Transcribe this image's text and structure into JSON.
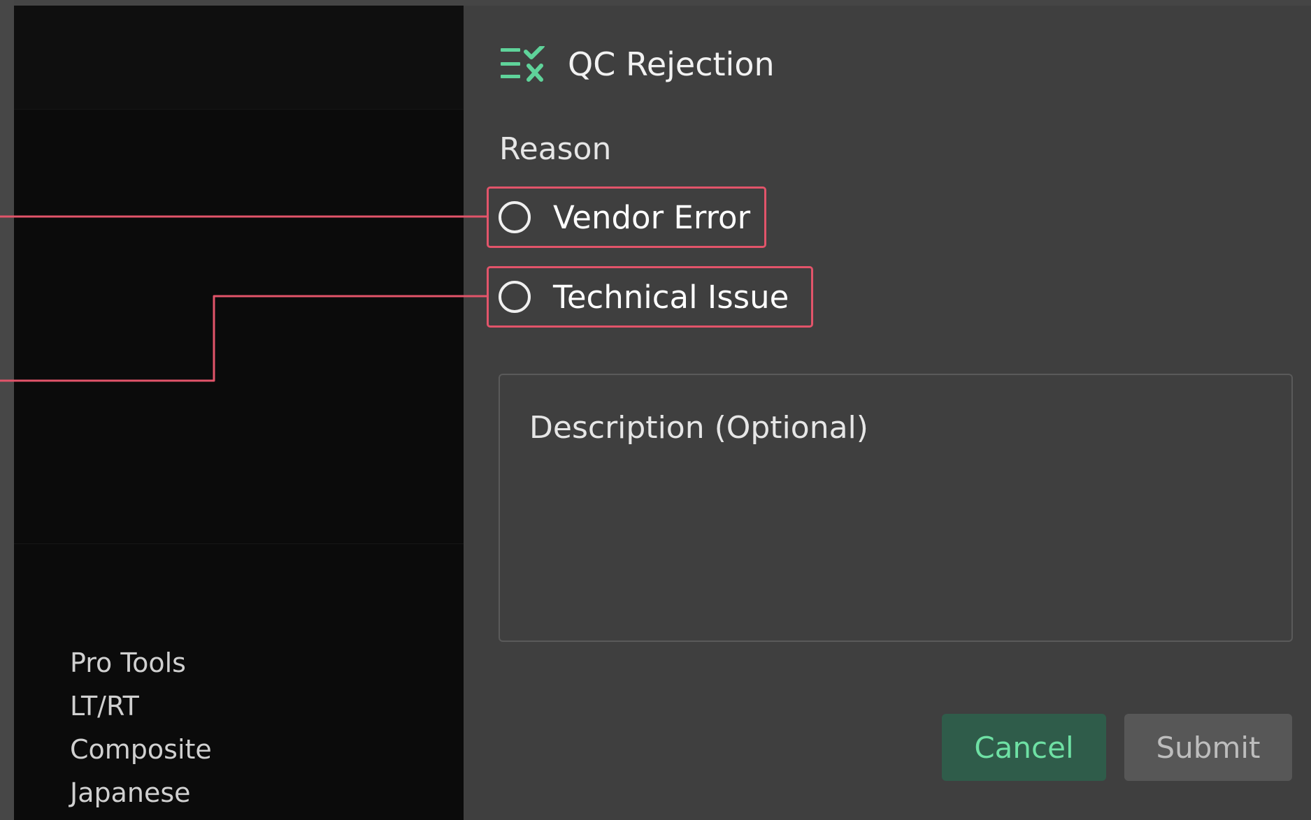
{
  "sidebar": {
    "items": [
      {
        "label": "Pro Tools"
      },
      {
        "label": "LT/RT"
      },
      {
        "label": "Composite"
      },
      {
        "label": "Japanese"
      }
    ]
  },
  "dialog": {
    "title": "QC Rejection",
    "title_icon": "checklist-reject-icon",
    "reason_label": "Reason",
    "options": [
      {
        "label": "Vendor Error",
        "selected": false
      },
      {
        "label": "Technical Issue",
        "selected": false
      }
    ],
    "description_placeholder": "Description (Optional)",
    "buttons": {
      "cancel_label": "Cancel",
      "submit_label": "Submit"
    }
  },
  "colors": {
    "accent_green": "#6ee0a4",
    "highlight_red": "#e2546a",
    "dialog_bg": "#3f3f3f",
    "panel_bg": "#0b0b0b"
  }
}
